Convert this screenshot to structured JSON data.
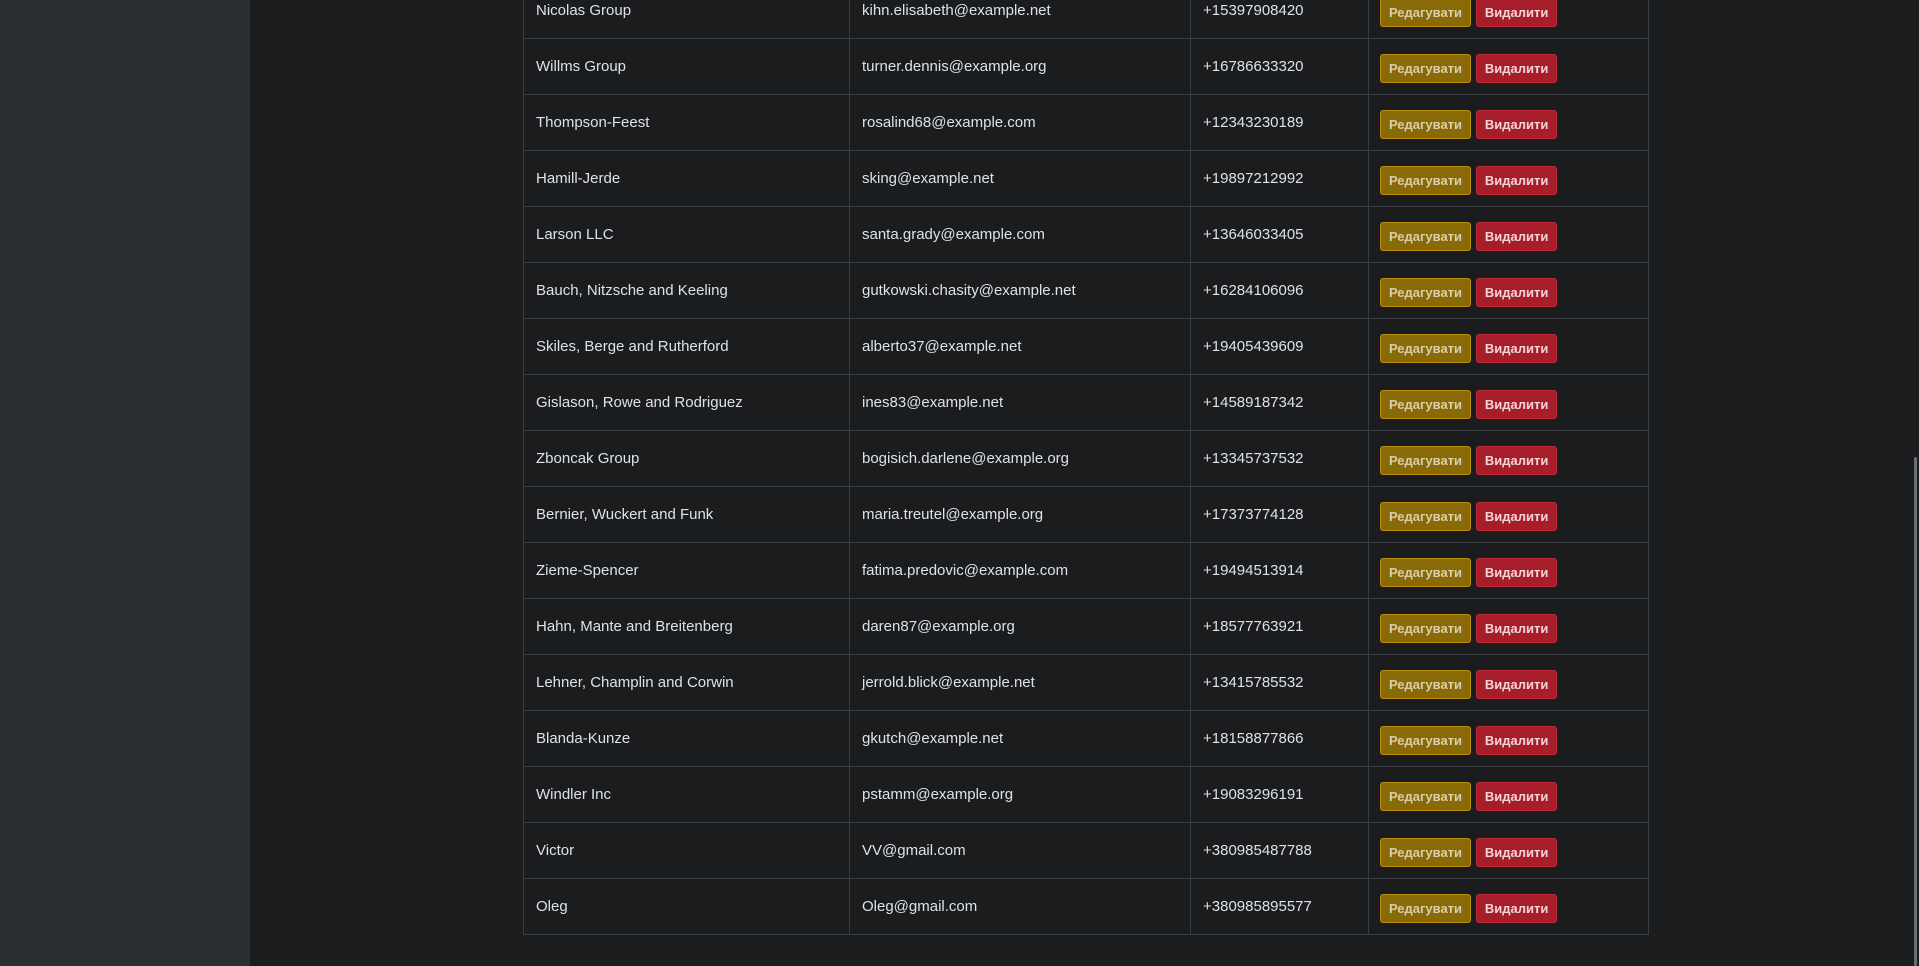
{
  "rows": [
    {
      "name": "Nicolas Group",
      "email": "kihn.elisabeth@example.net",
      "phone": "+15397908420"
    },
    {
      "name": "Willms Group",
      "email": "turner.dennis@example.org",
      "phone": "+16786633320"
    },
    {
      "name": "Thompson-Feest",
      "email": "rosalind68@example.com",
      "phone": "+12343230189"
    },
    {
      "name": "Hamill-Jerde",
      "email": "sking@example.net",
      "phone": "+19897212992"
    },
    {
      "name": "Larson LLC",
      "email": "santa.grady@example.com",
      "phone": "+13646033405"
    },
    {
      "name": "Bauch, Nitzsche and Keeling",
      "email": "gutkowski.chasity@example.net",
      "phone": "+16284106096"
    },
    {
      "name": "Skiles, Berge and Rutherford",
      "email": "alberto37@example.net",
      "phone": "+19405439609"
    },
    {
      "name": "Gislason, Rowe and Rodriguez",
      "email": "ines83@example.net",
      "phone": "+14589187342"
    },
    {
      "name": "Zboncak Group",
      "email": "bogisich.darlene@example.org",
      "phone": "+13345737532"
    },
    {
      "name": "Bernier, Wuckert and Funk",
      "email": "maria.treutel@example.org",
      "phone": "+17373774128"
    },
    {
      "name": "Zieme-Spencer",
      "email": "fatima.predovic@example.com",
      "phone": "+19494513914"
    },
    {
      "name": "Hahn, Mante and Breitenberg",
      "email": "daren87@example.org",
      "phone": "+18577763921"
    },
    {
      "name": "Lehner, Champlin and Corwin",
      "email": "jerrold.blick@example.net",
      "phone": "+13415785532"
    },
    {
      "name": "Blanda-Kunze",
      "email": "gkutch@example.net",
      "phone": "+18158877866"
    },
    {
      "name": "Windler Inc",
      "email": "pstamm@example.org",
      "phone": "+19083296191"
    },
    {
      "name": "Victor",
      "email": "VV@gmail.com",
      "phone": "+380985487788"
    },
    {
      "name": "Oleg",
      "email": "Oleg@gmail.com",
      "phone": "+380985895577"
    }
  ],
  "actions": {
    "edit_label": "Редагувати",
    "delete_label": "Видалити"
  },
  "colors": {
    "edit": "#8a6a06",
    "delete": "#a71d2a",
    "background": "#1b1c1e",
    "sidebar": "#2c2f31"
  }
}
